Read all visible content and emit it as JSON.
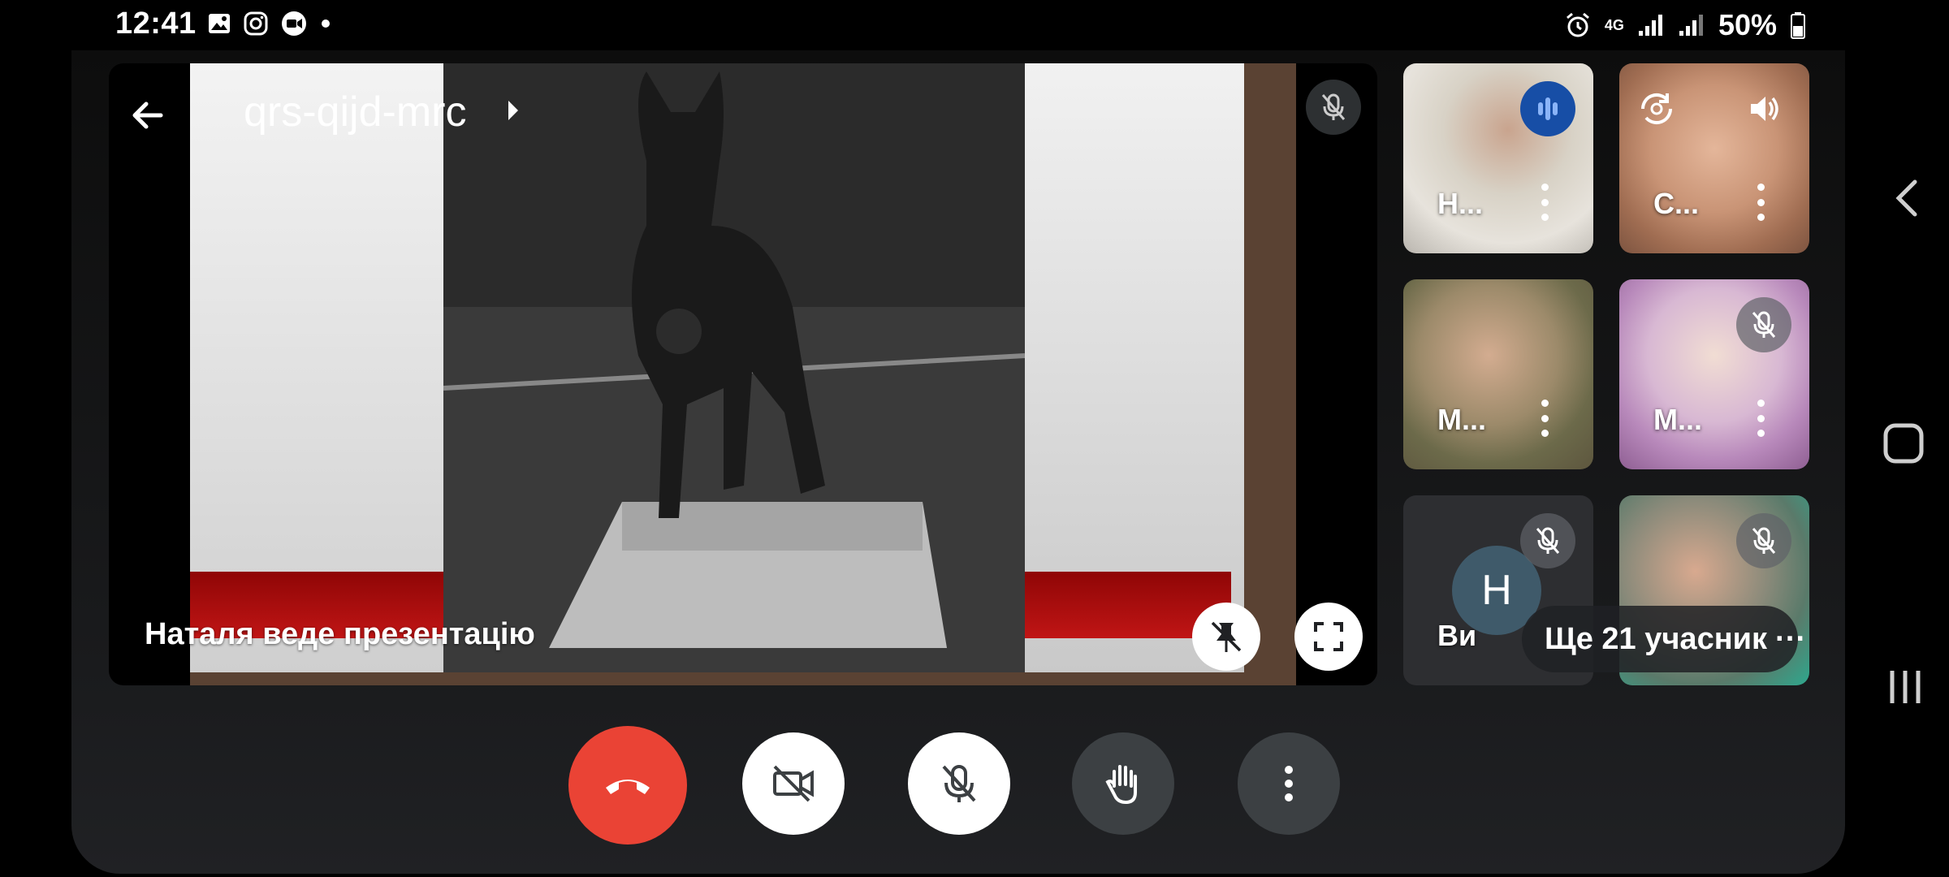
{
  "status_bar": {
    "time": "12:41",
    "battery": "50%",
    "network": "4G",
    "left_icons": [
      "gallery-icon",
      "instagram-icon",
      "video-record-icon",
      "dot-icon"
    ],
    "right_icons": [
      "alarm-icon",
      "4g-icon",
      "signal-icon",
      "signal-icon",
      "battery-icon"
    ]
  },
  "meeting": {
    "code": "qrs-qijd-mrc",
    "presenter_label": "Наталя веде презентацію",
    "more_participants": "Ще 21 учасник"
  },
  "participants": [
    {
      "name": "Н...",
      "status": "speaking"
    },
    {
      "name": "С...",
      "status": "audio"
    },
    {
      "name": "М...",
      "status": "none"
    },
    {
      "name": "М...",
      "status": "muted"
    },
    {
      "name": "Ви",
      "avatar_letter": "Н",
      "status": "muted"
    },
    {
      "name": "",
      "status": "muted"
    }
  ],
  "controls": {
    "end_call": "call-end-icon",
    "camera": "videocam-off-icon",
    "microphone": "mic-off-icon",
    "raise_hand": "hand-icon",
    "more": "more-vert-icon"
  },
  "colors": {
    "end_call": "#ea4335",
    "dark_control": "#3c4043",
    "speaking_badge": "#174ea6",
    "background": "#202124"
  }
}
